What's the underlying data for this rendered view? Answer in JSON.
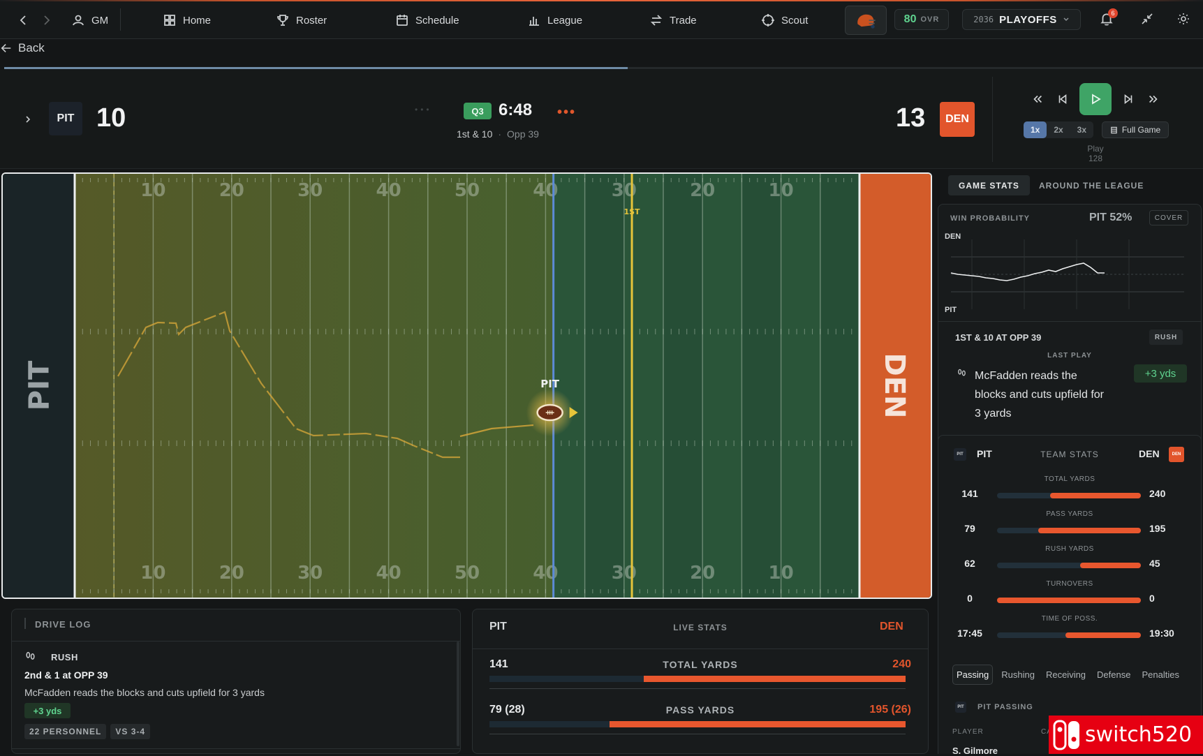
{
  "nav": {
    "user": "GM",
    "items": [
      {
        "label": "Home",
        "icon": "home-grid-icon"
      },
      {
        "label": "Roster",
        "icon": "trophy-icon"
      },
      {
        "label": "Schedule",
        "icon": "calendar-icon"
      },
      {
        "label": "League",
        "icon": "bar-chart-icon"
      },
      {
        "label": "Trade",
        "icon": "swap-icon"
      },
      {
        "label": "Scout",
        "icon": "crosshair-icon"
      }
    ],
    "ovr_value": "80",
    "ovr_label": "OVR",
    "season_year": "2036",
    "season_phase": "PLAYOFFS",
    "notification_count": "6"
  },
  "back_label": "Back",
  "game_progress": 0.52,
  "score": {
    "home_abbr": "PIT",
    "home_score": "10",
    "quarter": "Q3",
    "clock": "6:48",
    "down_distance": "1st & 10",
    "field_position": "Opp 39",
    "away_abbr": "DEN",
    "away_score": "13"
  },
  "playback": {
    "speeds": [
      "1x",
      "2x",
      "3x"
    ],
    "active_speed": "1x",
    "full_game_label": "Full Game",
    "play_label": "Play 128"
  },
  "field": {
    "home_endzone": "PIT",
    "away_endzone": "DEN",
    "yard_numbers": [
      "10",
      "20",
      "30",
      "40",
      "50",
      "40",
      "30",
      "20",
      "10"
    ],
    "first_down_label": "1ST",
    "ball_team": "PIT"
  },
  "tabs": {
    "game_stats": "GAME STATS",
    "around_league": "AROUND THE LEAGUE"
  },
  "win_prob": {
    "title": "WIN PROBABILITY",
    "value": "PIT 52%",
    "cover_label": "COVER",
    "top_team": "DEN",
    "bottom_team": "PIT",
    "chart_data": {
      "type": "line",
      "values": [
        52,
        50,
        49,
        48,
        47,
        45,
        44,
        42,
        41,
        43,
        46,
        48,
        51,
        53,
        56,
        54,
        58,
        61,
        64,
        66,
        60,
        52,
        52
      ]
    }
  },
  "last_play": {
    "situation": "1ST & 10 AT OPP 39",
    "type_badge": "RUSH",
    "header": "LAST PLAY",
    "text": "McFadden reads the blocks and cuts upfield for 3 yards",
    "gain": "+3 yds"
  },
  "team_stats": {
    "home": "PIT",
    "title": "TEAM STATS",
    "away": "DEN",
    "rows": [
      {
        "label": "TOTAL YARDS",
        "home": "141",
        "away": "240",
        "home_val": 141,
        "away_val": 240
      },
      {
        "label": "PASS YARDS",
        "home": "79",
        "away": "195",
        "home_val": 79,
        "away_val": 195
      },
      {
        "label": "RUSH YARDS",
        "home": "62",
        "away": "45",
        "home_val": 62,
        "away_val": 45
      },
      {
        "label": "TURNOVERS",
        "home": "0",
        "away": "0",
        "home_val": 0,
        "away_val": 0
      },
      {
        "label": "TIME OF POSS.",
        "home": "17:45",
        "away": "19:30",
        "home_val": 1065,
        "away_val": 1170
      }
    ]
  },
  "box_tabs": [
    "Passing",
    "Rushing",
    "Receiving",
    "Defense",
    "Penalties"
  ],
  "passing": {
    "title": "PIT PASSING",
    "col_player": "PLAYER",
    "col_ca": "CA",
    "first_player": "S. Gilmore"
  },
  "drive_log": {
    "title": "DRIVE LOG",
    "entry": {
      "type": "RUSH",
      "situation": "2nd & 1 at OPP 39",
      "text": "McFadden reads the blocks and cuts upfield for 3 yards",
      "gain": "+3 yds",
      "tags": [
        "22 PERSONNEL",
        "VS 3-4"
      ]
    }
  },
  "live_stats": {
    "home": "PIT",
    "title": "LIVE STATS",
    "away": "DEN",
    "rows": [
      {
        "label": "TOTAL YARDS",
        "home": "141",
        "away": "240",
        "home_val": 141,
        "away_val": 240
      },
      {
        "label": "PASS YARDS",
        "home": "79 (28)",
        "away": "195 (26)",
        "home_val": 79,
        "away_val": 195
      }
    ]
  },
  "watermark": "switch520"
}
